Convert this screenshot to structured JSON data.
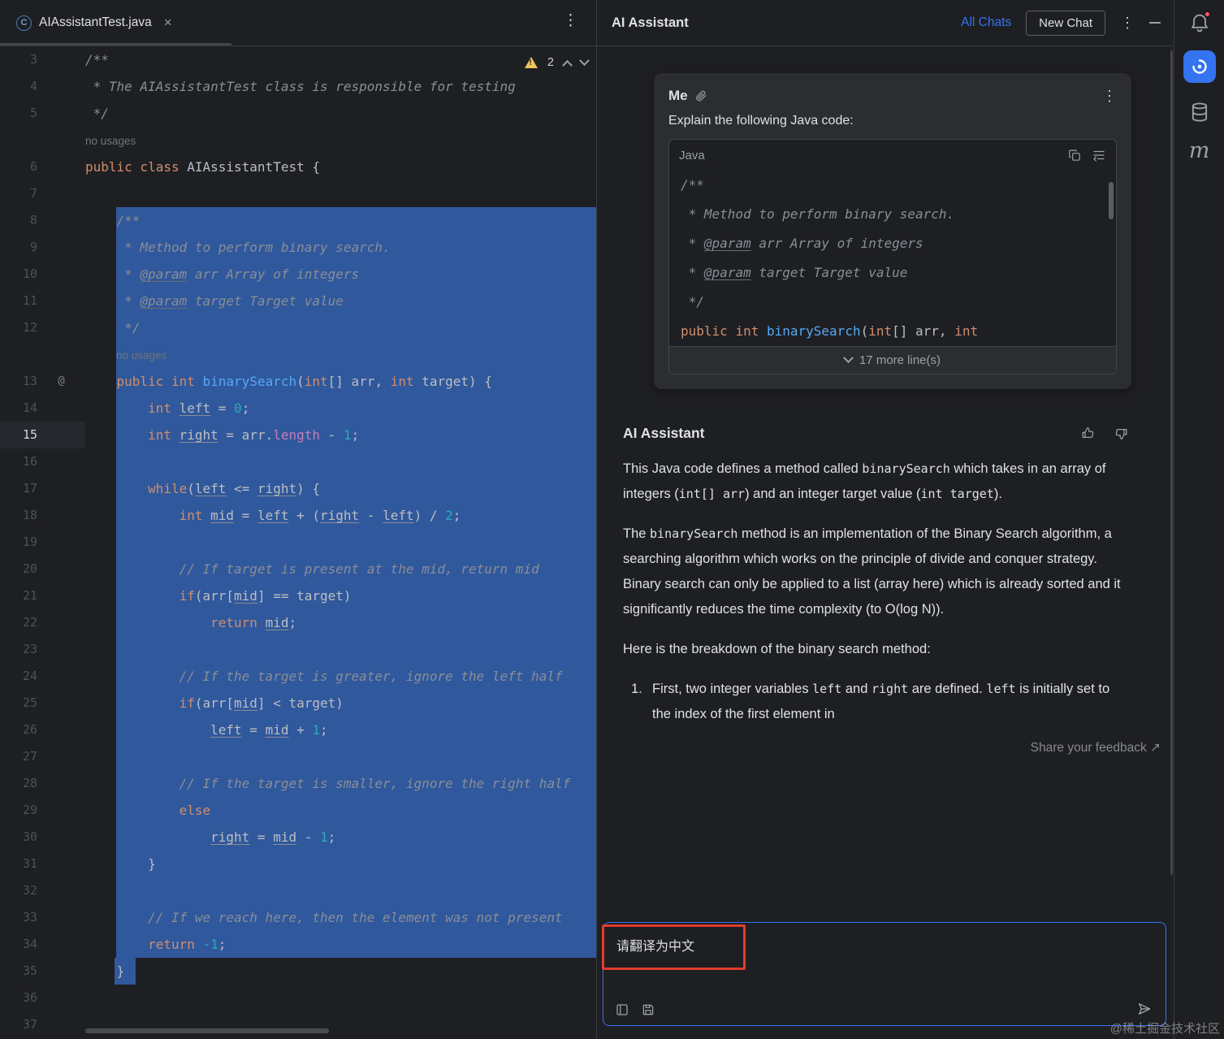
{
  "colors": {
    "accent_blue": "#3574f0",
    "selection_blue": "#30589c",
    "warning_yellow": "#f2c55c",
    "annotation_red": "#e23b2e",
    "notification_red": "#f75464"
  },
  "icons": {
    "kebab": "⋮",
    "close": "×",
    "class_letter": "C",
    "gutter_annotation": "@",
    "feedback_arrow": "↗"
  },
  "editor": {
    "tab_title": "AIAssistantTest.java",
    "warning_count": "2",
    "rows": [
      {
        "n": "3",
        "seg": [
          [
            "cm",
            "/**"
          ]
        ]
      },
      {
        "n": "4",
        "seg": [
          [
            "cm",
            " * The AIAssistantTest class is responsible for testing"
          ]
        ]
      },
      {
        "n": "5",
        "seg": [
          [
            "cm",
            " */"
          ]
        ]
      },
      {
        "hint": "no usages",
        "ind": 0
      },
      {
        "n": "6",
        "seg": [
          [
            "kw",
            "public class"
          ],
          [
            "pl",
            " AIAssistantTest {"
          ]
        ]
      },
      {
        "n": "7",
        "seg": []
      },
      {
        "n": "8",
        "sel": 1,
        "seg": [
          [
            "cm",
            "    /**"
          ]
        ]
      },
      {
        "n": "9",
        "sel": 1,
        "seg": [
          [
            "cm",
            "     * Method to perform binary search."
          ]
        ]
      },
      {
        "n": "10",
        "sel": 1,
        "seg": [
          [
            "cm",
            "     * "
          ],
          [
            "doc",
            "@param"
          ],
          [
            "cm",
            " arr Array of integers"
          ]
        ]
      },
      {
        "n": "11",
        "sel": 1,
        "seg": [
          [
            "cm",
            "     * "
          ],
          [
            "doc",
            "@param"
          ],
          [
            "cm",
            " target Target value"
          ]
        ]
      },
      {
        "n": "12",
        "sel": 1,
        "seg": [
          [
            "cm",
            "     */"
          ]
        ]
      },
      {
        "hint": "no usages",
        "ind": 1,
        "sel": 1
      },
      {
        "n": "13",
        "sel": 1,
        "at": 1,
        "seg": [
          [
            "pl",
            "    "
          ],
          [
            "kw",
            "public"
          ],
          [
            "pl",
            " "
          ],
          [
            "kw",
            "int"
          ],
          [
            "pl",
            " "
          ],
          [
            "fn",
            "binarySearch"
          ],
          [
            "pl",
            "("
          ],
          [
            "kw",
            "int"
          ],
          [
            "pl",
            "[] arr, "
          ],
          [
            "kw",
            "int"
          ],
          [
            "pl",
            " target) {"
          ]
        ]
      },
      {
        "n": "14",
        "sel": 1,
        "seg": [
          [
            "pl",
            "        "
          ],
          [
            "kw",
            "int"
          ],
          [
            "pl",
            " "
          ],
          [
            "var",
            "left"
          ],
          [
            "pl",
            " = "
          ],
          [
            "num",
            "0"
          ],
          [
            "pl",
            ";"
          ]
        ]
      },
      {
        "n": "15",
        "sel": 1,
        "cur": 1,
        "seg": [
          [
            "pl",
            "        "
          ],
          [
            "kw",
            "int"
          ],
          [
            "pl",
            " "
          ],
          [
            "var",
            "right"
          ],
          [
            "pl",
            " = arr."
          ],
          [
            "fld",
            "length"
          ],
          [
            "pl",
            " - "
          ],
          [
            "num",
            "1"
          ],
          [
            "pl",
            ";"
          ]
        ]
      },
      {
        "n": "16",
        "sel": 1,
        "seg": []
      },
      {
        "n": "17",
        "sel": 1,
        "seg": [
          [
            "pl",
            "        "
          ],
          [
            "kw",
            "while"
          ],
          [
            "pl",
            "("
          ],
          [
            "var",
            "left"
          ],
          [
            "pl",
            " <= "
          ],
          [
            "var",
            "right"
          ],
          [
            "pl",
            ") {"
          ]
        ]
      },
      {
        "n": "18",
        "sel": 1,
        "seg": [
          [
            "pl",
            "            "
          ],
          [
            "kw",
            "int"
          ],
          [
            "pl",
            " "
          ],
          [
            "var",
            "mid"
          ],
          [
            "pl",
            " = "
          ],
          [
            "var",
            "left"
          ],
          [
            "pl",
            " + ("
          ],
          [
            "var",
            "right"
          ],
          [
            "pl",
            " - "
          ],
          [
            "var",
            "left"
          ],
          [
            "pl",
            ") / "
          ],
          [
            "num",
            "2"
          ],
          [
            "pl",
            ";"
          ]
        ]
      },
      {
        "n": "19",
        "sel": 1,
        "seg": []
      },
      {
        "n": "20",
        "sel": 1,
        "seg": [
          [
            "cm",
            "            // If target is present at the mid, return mid"
          ]
        ]
      },
      {
        "n": "21",
        "sel": 1,
        "seg": [
          [
            "pl",
            "            "
          ],
          [
            "kw",
            "if"
          ],
          [
            "pl",
            "(arr["
          ],
          [
            "var",
            "mid"
          ],
          [
            "pl",
            "] == target)"
          ]
        ]
      },
      {
        "n": "22",
        "sel": 1,
        "seg": [
          [
            "pl",
            "                "
          ],
          [
            "kw",
            "return"
          ],
          [
            "pl",
            " "
          ],
          [
            "var",
            "mid"
          ],
          [
            "pl",
            ";"
          ]
        ]
      },
      {
        "n": "23",
        "sel": 1,
        "seg": []
      },
      {
        "n": "24",
        "sel": 1,
        "seg": [
          [
            "cm",
            "            // If the target is greater, ignore the left half"
          ]
        ]
      },
      {
        "n": "25",
        "sel": 1,
        "seg": [
          [
            "pl",
            "            "
          ],
          [
            "kw",
            "if"
          ],
          [
            "pl",
            "(arr["
          ],
          [
            "var",
            "mid"
          ],
          [
            "pl",
            "] < target)"
          ]
        ]
      },
      {
        "n": "26",
        "sel": 1,
        "seg": [
          [
            "pl",
            "                "
          ],
          [
            "var",
            "left"
          ],
          [
            "pl",
            " = "
          ],
          [
            "var",
            "mid"
          ],
          [
            "pl",
            " + "
          ],
          [
            "num",
            "1"
          ],
          [
            "pl",
            ";"
          ]
        ]
      },
      {
        "n": "27",
        "sel": 1,
        "seg": []
      },
      {
        "n": "28",
        "sel": 1,
        "seg": [
          [
            "cm",
            "            // If the target is smaller, ignore the right half"
          ]
        ]
      },
      {
        "n": "29",
        "sel": 1,
        "seg": [
          [
            "pl",
            "            "
          ],
          [
            "kw",
            "else"
          ]
        ]
      },
      {
        "n": "30",
        "sel": 1,
        "seg": [
          [
            "pl",
            "                "
          ],
          [
            "var",
            "right"
          ],
          [
            "pl",
            " = "
          ],
          [
            "var",
            "mid"
          ],
          [
            "pl",
            " - "
          ],
          [
            "num",
            "1"
          ],
          [
            "pl",
            ";"
          ]
        ]
      },
      {
        "n": "31",
        "sel": 1,
        "seg": [
          [
            "pl",
            "        }"
          ]
        ]
      },
      {
        "n": "32",
        "sel": 1,
        "seg": []
      },
      {
        "n": "33",
        "sel": 1,
        "seg": [
          [
            "cm",
            "        // If we reach here, then the element was not present"
          ]
        ]
      },
      {
        "n": "34",
        "sel": 1,
        "seg": [
          [
            "pl",
            "        "
          ],
          [
            "kw",
            "return"
          ],
          [
            "pl",
            " "
          ],
          [
            "num",
            "-1"
          ],
          [
            "pl",
            ";"
          ]
        ]
      },
      {
        "n": "35",
        "selp": 1,
        "seg": [
          [
            "pl",
            "    }"
          ]
        ]
      },
      {
        "n": "36",
        "seg": []
      },
      {
        "n": "37",
        "seg": []
      }
    ]
  },
  "assistant": {
    "title": "AI Assistant",
    "all_chats": "All Chats",
    "new_chat": "New Chat",
    "user": {
      "name": "Me",
      "prompt": "Explain the following Java code:",
      "code_lang": "Java",
      "code_rows": [
        [
          [
            "cm",
            "/**"
          ]
        ],
        [
          [
            "cm",
            " * Method to perform binary search."
          ]
        ],
        [
          [
            "cm",
            " * "
          ],
          [
            "doc",
            "@param"
          ],
          [
            "cm",
            " arr Array of integers"
          ]
        ],
        [
          [
            "cm",
            " * "
          ],
          [
            "doc",
            "@param"
          ],
          [
            "cm",
            " target Target value"
          ]
        ],
        [
          [
            "cm",
            " */"
          ]
        ],
        [
          [
            "kw",
            "public"
          ],
          [
            "pl",
            " "
          ],
          [
            "kw",
            "int"
          ],
          [
            "pl",
            " "
          ],
          [
            "fn",
            "binarySearch"
          ],
          [
            "pl",
            "("
          ],
          [
            "kw",
            "int"
          ],
          [
            "pl",
            "[] arr, "
          ],
          [
            "kw",
            "int"
          ]
        ]
      ],
      "more_lines": "17 more line(s)"
    },
    "response": {
      "author": "AI Assistant",
      "paragraphs": [
        {
          "parts": [
            [
              "t",
              "This Java code defines a method called "
            ],
            [
              "c",
              "binarySearch"
            ],
            [
              "t",
              " which takes in an array of integers ("
            ],
            [
              "c",
              "int[] arr"
            ],
            [
              "t",
              ") and an integer target value ("
            ],
            [
              "c",
              "int target"
            ],
            [
              "t",
              ")."
            ]
          ]
        },
        {
          "parts": [
            [
              "t",
              "The "
            ],
            [
              "c",
              "binarySearch"
            ],
            [
              "t",
              " method is an implementation of the Binary Search algorithm, a searching algorithm which works on the principle of divide and conquer strategy. Binary search can only be applied to a list (array here) which is already sorted and it significantly reduces the time complexity (to O(log N))."
            ]
          ]
        },
        {
          "parts": [
            [
              "t",
              "Here is the breakdown of the binary search method:"
            ]
          ]
        },
        {
          "list": "1.",
          "parts": [
            [
              "t",
              "First, two integer variables "
            ],
            [
              "c",
              "left"
            ],
            [
              "t",
              " and "
            ],
            [
              "c",
              "right"
            ],
            [
              "t",
              " are defined. "
            ],
            [
              "c",
              "left"
            ],
            [
              "t",
              " is initially set to the index of the first element in"
            ]
          ]
        }
      ]
    },
    "feedback": "Share your feedback ↗",
    "input": {
      "value": "请翻译为中文"
    }
  },
  "watermark": "@稀土掘金技术社区"
}
